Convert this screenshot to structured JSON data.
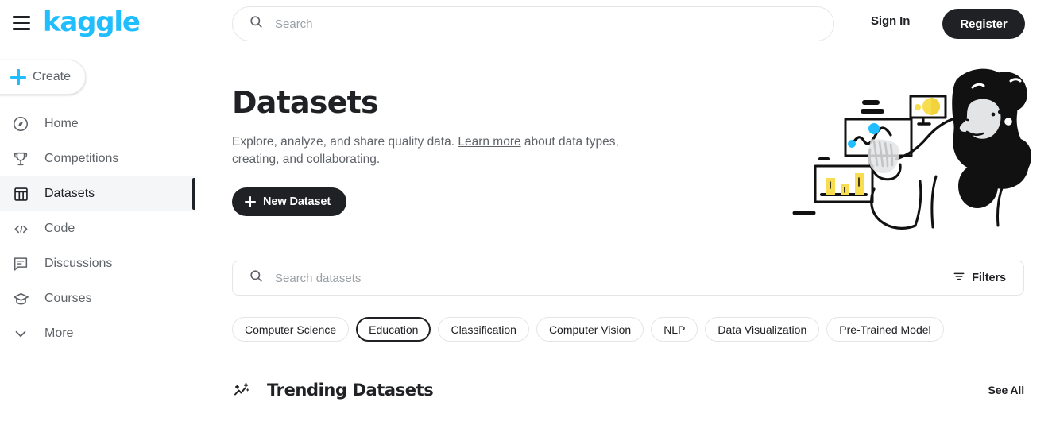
{
  "brand": {
    "logo_text": "kaggle",
    "accent_color": "#20beff",
    "dark_color": "#202124",
    "illustration_yellow": "#f8de4f",
    "illustration_cyan": "#20beff"
  },
  "sidebar": {
    "menu_icon": "hamburger-icon",
    "create_label": "Create",
    "create_icon": "plus-icon",
    "items": [
      {
        "label": "Home",
        "icon": "compass-icon",
        "active": false
      },
      {
        "label": "Competitions",
        "icon": "trophy-icon",
        "active": false
      },
      {
        "label": "Datasets",
        "icon": "table-icon",
        "active": true
      },
      {
        "label": "Code",
        "icon": "code-brackets-icon",
        "active": false
      },
      {
        "label": "Discussions",
        "icon": "comment-icon",
        "active": false
      },
      {
        "label": "Courses",
        "icon": "graduation-cap-icon",
        "active": false
      },
      {
        "label": "More",
        "icon": "chevron-down-icon",
        "active": false
      }
    ]
  },
  "topbar": {
    "search_placeholder": "Search",
    "search_value": "",
    "search_icon": "search-icon",
    "sign_in_label": "Sign In",
    "register_label": "Register"
  },
  "hero": {
    "title": "Datasets",
    "description_before": "Explore, analyze, and share quality data. ",
    "link_label": "Learn more",
    "description_after": " about data types, creating, and collaborating.",
    "new_dataset_label": "New Dataset",
    "new_dataset_icon": "plus-icon",
    "illustration_name": "person-with-charts-illustration"
  },
  "dataset_search": {
    "placeholder": "Search datasets",
    "value": "",
    "search_icon": "search-icon",
    "filters_label": "Filters",
    "filters_icon": "filter-icon"
  },
  "chips": [
    {
      "label": "Computer Science",
      "selected": false
    },
    {
      "label": "Education",
      "selected": true
    },
    {
      "label": "Classification",
      "selected": false
    },
    {
      "label": "Computer Vision",
      "selected": false
    },
    {
      "label": "NLP",
      "selected": false
    },
    {
      "label": "Data Visualization",
      "selected": false
    },
    {
      "label": "Pre-Trained Model",
      "selected": false
    }
  ],
  "trending": {
    "icon": "trending-up-sparkle-icon",
    "title": "Trending Datasets",
    "see_all_label": "See All"
  }
}
